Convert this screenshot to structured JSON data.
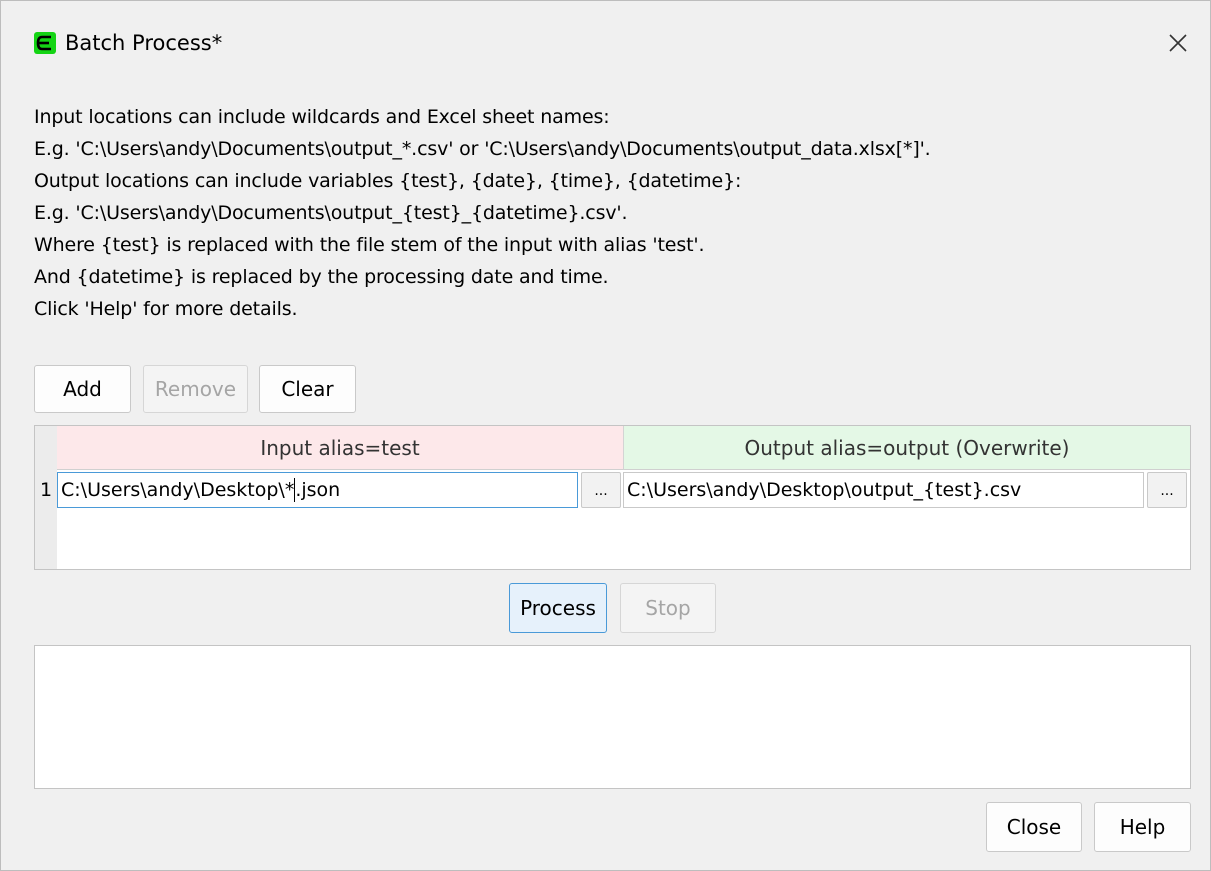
{
  "window": {
    "title": "Batch Process*",
    "app_icon": "green-e-logo-icon",
    "close_icon": "close-icon"
  },
  "description": {
    "lines": [
      "Input locations can include wildcards and Excel sheet names:",
      "E.g. 'C:\\Users\\andy\\Documents\\output_*.csv' or 'C:\\Users\\andy\\Documents\\output_data.xlsx[*]'.",
      "Output locations can include variables {test}, {date}, {time}, {datetime}:",
      "E.g. 'C:\\Users\\andy\\Documents\\output_{test}_{datetime}.csv'.",
      "Where {test} is replaced with the file stem of the input with alias 'test'.",
      "And {datetime} is replaced by the processing date and time.",
      "Click 'Help' for more details."
    ]
  },
  "toolbar": {
    "add_label": "Add",
    "remove_label": "Remove",
    "clear_label": "Clear"
  },
  "grid": {
    "input_header": "Input alias=test",
    "output_header": "Output alias=output (Overwrite)",
    "rows": [
      {
        "number": "1",
        "input_before_caret": "C:\\Users\\andy\\Desktop\\*",
        "input_after_caret": ".json",
        "output_value": "C:\\Users\\andy\\Desktop\\output_{test}.csv",
        "browse_label": "..."
      }
    ]
  },
  "actions": {
    "process_label": "Process",
    "stop_label": "Stop"
  },
  "footer": {
    "close_label": "Close",
    "help_label": "Help"
  },
  "colors": {
    "input_header_bg": "#fde8ea",
    "output_header_bg": "#e4f8e6",
    "app_icon_green": "#14d414",
    "focus_blue": "#4a9ad8"
  }
}
